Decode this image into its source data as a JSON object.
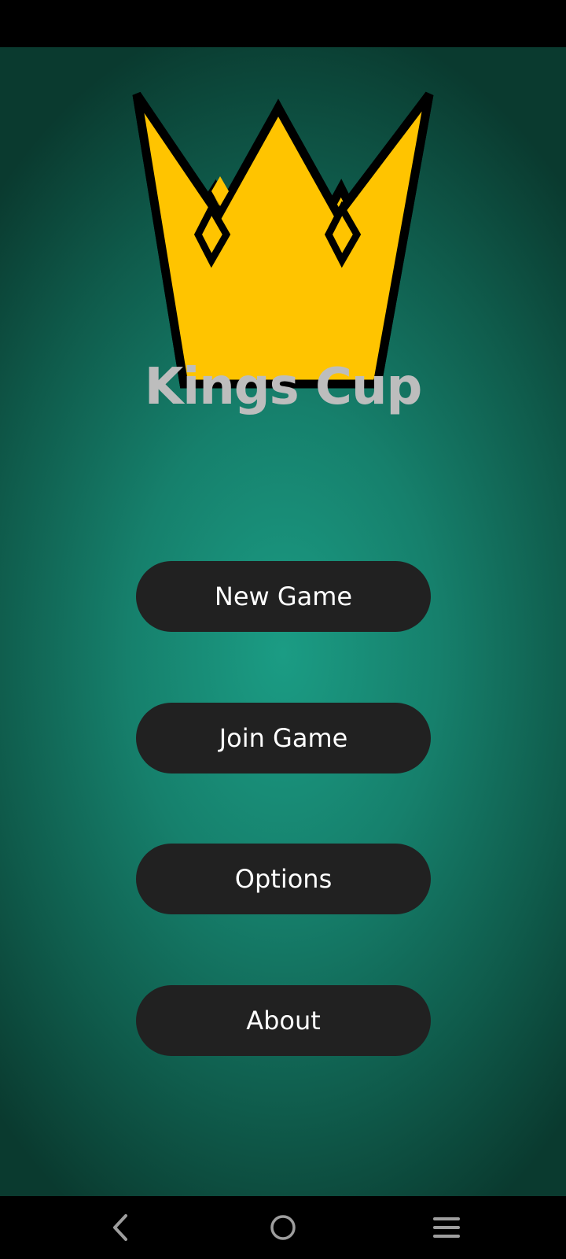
{
  "app": {
    "title": "Kings Cup"
  },
  "logo": {
    "icon": "crown-icon",
    "fill_color": "#FFC400",
    "stroke_color": "#000000"
  },
  "menu": {
    "buttons": [
      {
        "label": "New Game"
      },
      {
        "label": "Join Game"
      },
      {
        "label": "Options"
      },
      {
        "label": "About"
      }
    ],
    "button_color": "#212121",
    "text_color": "#FFFFFF"
  },
  "theme": {
    "background_center": "#1B9C84",
    "background_edge": "#0A3A2F",
    "title_color": "#BDBDBD"
  },
  "system_nav": {
    "back_icon": "chevron-left-icon",
    "home_icon": "circle-home-icon",
    "menu_icon": "hamburger-menu-icon"
  }
}
